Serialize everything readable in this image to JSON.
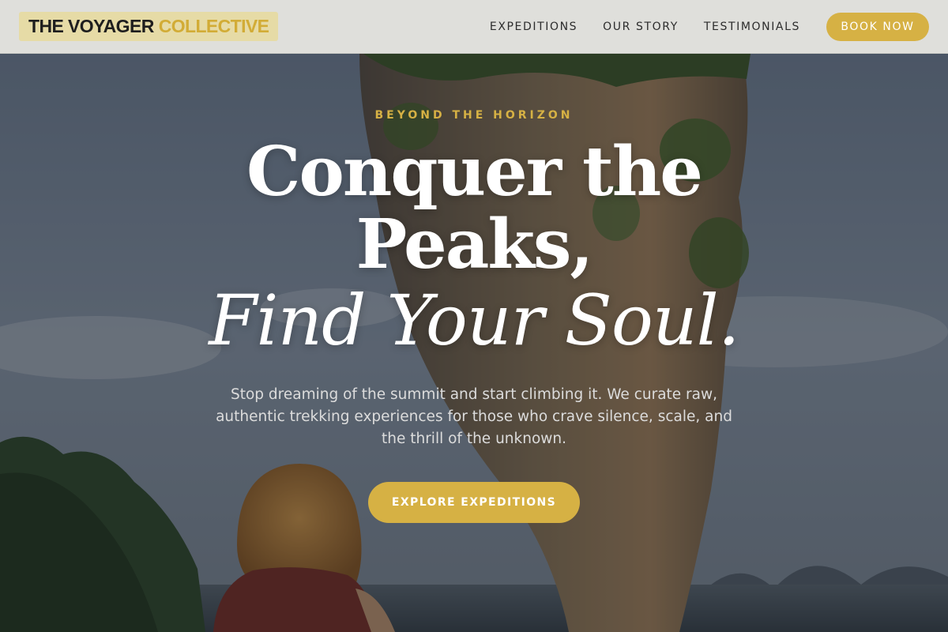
{
  "brand": {
    "name_part1": "THE VOYAGER",
    "name_part2": "COLLECTIVE",
    "accent_color": "#d6b144"
  },
  "nav": {
    "links": [
      {
        "label": "EXPEDITIONS"
      },
      {
        "label": "OUR STORY"
      },
      {
        "label": "TESTIMONIALS"
      }
    ],
    "book_button": "BOOK NOW"
  },
  "hero": {
    "eyebrow": "BEYOND THE HORIZON",
    "title_line1": "Conquer the",
    "title_line2": "Peaks,",
    "title_line3": "Find Your Soul.",
    "subtitle": "Stop dreaming of the summit and start climbing it. We curate raw, authentic trekking experiences for those who crave silence, scale, and the thrill of the unknown.",
    "cta": "EXPLORE EXPEDITIONS"
  }
}
